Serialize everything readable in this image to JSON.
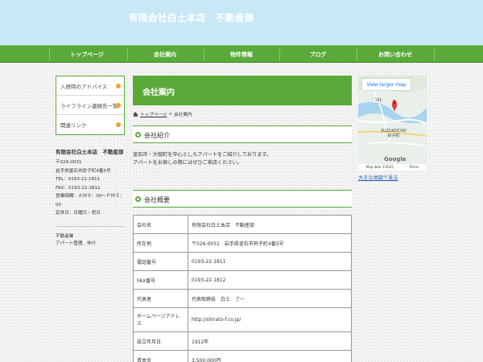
{
  "header": {
    "title": "有限会社白土本店　不動産部"
  },
  "nav": {
    "items": [
      "トップページ",
      "会社案内",
      "物件情報",
      "ブログ",
      "お問い合わせ"
    ]
  },
  "sidebar": {
    "menu": [
      "入居時のアドバイス",
      "ライフライン連絡先一覧",
      "関連リンク"
    ],
    "company": "有限会社白土本店　不動産部",
    "postal": "〒026-0031",
    "address": "岩手県釜石市鈴子町4番5号",
    "tel": "TEL：0193-22-1811",
    "fax": "FAX：0193-22-1812",
    "hours": "営業時間：ＡＭ９：00～ＰＭ５：00",
    "holiday": "定休日：日曜日・祝日",
    "category_title": "不動産業",
    "category_detail": "アパート管理、仲介"
  },
  "main": {
    "title": "会社案内",
    "breadcrumb": {
      "home": "トップページ",
      "sep": ">",
      "current": "会社案内"
    },
    "section1": "会社紹介",
    "intro_line1": "釜石市・大槌町を中心としたアパートをご紹介しております。",
    "intro_line2": "アパートをお探しの際にはぜひご来店ください。",
    "section2": "会社概要",
    "table": [
      {
        "k": "会社名",
        "v": "有限会社白土本店　不動産部"
      },
      {
        "k": "所在地",
        "v": "〒026-0031　岩手県釜石市鈴子町4番5号"
      },
      {
        "k": "電話番号",
        "v": "0193-22-1811"
      },
      {
        "k": "FAX番号",
        "v": "0193-22-1812"
      },
      {
        "k": "代表者",
        "v": "代表取締役　白土　了一"
      },
      {
        "k": "ホームページアドレス",
        "v": "http://shirato-f.co.jp/"
      },
      {
        "k": "設立年月日",
        "v": "1912年"
      },
      {
        "k": "資本金",
        "v": "3,500,000円"
      }
    ]
  },
  "map": {
    "button": "View larger map",
    "route": "283",
    "place_en": "SUZUKOCHO",
    "place_ja": "鈴子町",
    "google": "Google",
    "data": "Map data ©2025",
    "terms": "Terms",
    "big_link": "大きな地図で見る"
  },
  "colors": {
    "header_bg": "#c9e8f7",
    "nav_green": "#5aaa3a",
    "bullet_orange": "#f0a030"
  }
}
